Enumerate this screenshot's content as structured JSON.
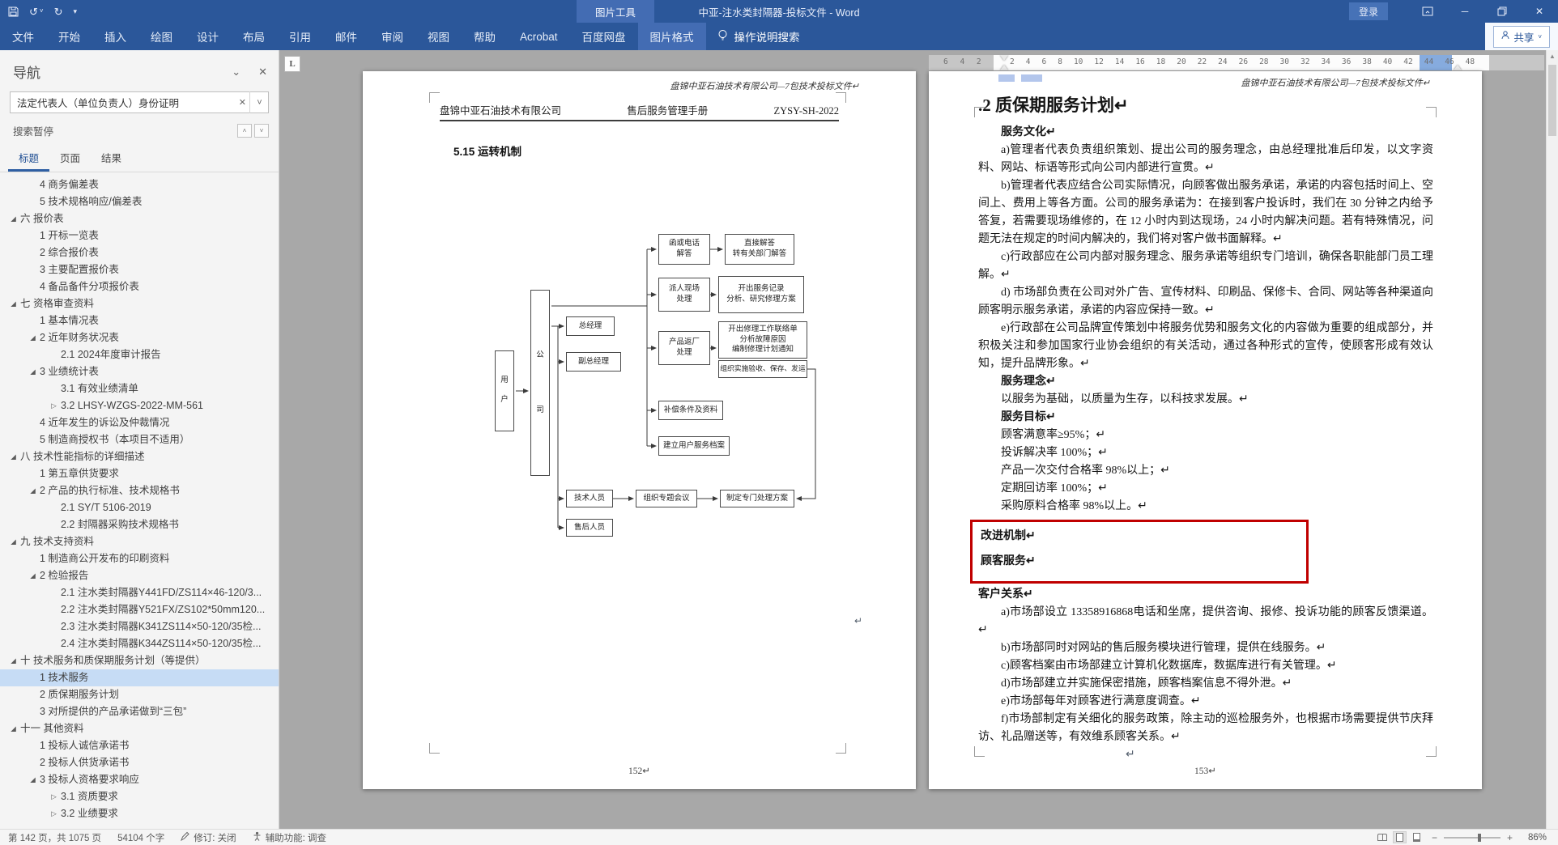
{
  "titlebar": {
    "title": "中亚-注水类封隔器-投标文件 - Word",
    "context_group": "图片工具",
    "signin_label": "登录"
  },
  "ribbon": {
    "tabs": [
      "文件",
      "开始",
      "插入",
      "绘图",
      "设计",
      "布局",
      "引用",
      "邮件",
      "审阅",
      "视图",
      "帮助",
      "Acrobat",
      "百度网盘",
      "图片格式"
    ],
    "search_label": "操作说明搜索",
    "share_label": "共享"
  },
  "nav": {
    "title": "导航",
    "search_value": "法定代表人（单位负责人）身份证明",
    "search_status": "搜索暂停",
    "tabs": [
      "标题",
      "页面",
      "结果"
    ],
    "items": [
      {
        "tri": "",
        "label": "4 商务偏差表"
      },
      {
        "tri": "",
        "label": "5 技术规格响应/偏差表"
      },
      {
        "tri": "◢",
        "label": "六 报价表"
      },
      {
        "tri": "",
        "label": "1 开标一览表"
      },
      {
        "tri": "",
        "label": "2 综合报价表"
      },
      {
        "tri": "",
        "label": "3 主要配置报价表"
      },
      {
        "tri": "",
        "label": "4 备品备件分项报价表"
      },
      {
        "tri": "◢",
        "label": "七 资格审查资料"
      },
      {
        "tri": "",
        "label": "1 基本情况表"
      },
      {
        "tri": "◢",
        "label": "2 近年财务状况表"
      },
      {
        "tri": "",
        "label": "2.1 2024年度审计报告"
      },
      {
        "tri": "◢",
        "label": "3 业绩统计表"
      },
      {
        "tri": "",
        "label": "3.1 有效业绩清单"
      },
      {
        "tri": "▷",
        "label": "3.2 LHSY-WZGS-2022-MM-561"
      },
      {
        "tri": "",
        "label": "4 近年发生的诉讼及仲裁情况"
      },
      {
        "tri": "",
        "label": "5 制造商授权书（本项目不适用）"
      },
      {
        "tri": "◢",
        "label": "八 技术性能指标的详细描述"
      },
      {
        "tri": "",
        "label": "1 第五章供货要求"
      },
      {
        "tri": "◢",
        "label": "2 产品的执行标准、技术规格书"
      },
      {
        "tri": "",
        "label": "2.1 SY/T 5106-2019"
      },
      {
        "tri": "",
        "label": "2.2 封隔器采购技术规格书"
      },
      {
        "tri": "◢",
        "label": "九 技术支持资料"
      },
      {
        "tri": "",
        "label": "1 制造商公开发布的印刷资料"
      },
      {
        "tri": "◢",
        "label": "2 检验报告"
      },
      {
        "tri": "",
        "label": "2.1 注水类封隔器Y441FD/ZS114×46-120/3..."
      },
      {
        "tri": "",
        "label": "2.2 注水类封隔器Y521FX/ZS102*50mm120..."
      },
      {
        "tri": "",
        "label": "2.3 注水类封隔器K341ZS114×50-120/35检..."
      },
      {
        "tri": "",
        "label": "2.4 注水类封隔器K344ZS114×50-120/35检..."
      },
      {
        "tri": "◢",
        "label": "十 技术服务和质保期服务计划（等提供）"
      },
      {
        "tri": "",
        "label": "1 技术服务"
      },
      {
        "tri": "",
        "label": "2 质保期服务计划"
      },
      {
        "tri": "",
        "label": "3 对所提供的产品承诺做到“三包”"
      },
      {
        "tri": "◢",
        "label": "十一 其他资料"
      },
      {
        "tri": "",
        "label": "1 投标人诚信承诺书"
      },
      {
        "tri": "",
        "label": "2 投标人供货承诺书"
      },
      {
        "tri": "◢",
        "label": "3 投标人资格要求响应"
      },
      {
        "tri": "▷",
        "label": "3.1 资质要求"
      },
      {
        "tri": "▷",
        "label": "3.2 业绩要求"
      }
    ]
  },
  "ruler": {
    "tab_selector": "L",
    "margin_numbers": "6 4 2",
    "numbers": "2 4 6 8 10 12 14 16 18 20 22 24 26 28 30 32 34 36 38 40 42 44 46 48"
  },
  "left_page": {
    "top_header": "盘锦中亚石油技术有限公司—7包技术投标文件↵",
    "company": "盘锦中亚石油技术有限公司",
    "manual": "售后服务管理手册",
    "doc_code": "ZYSY-SH-2022",
    "section": "5.15 运转机制",
    "pilcrow": "↵",
    "page_number": "152↵"
  },
  "flow": {
    "user": "用\n户",
    "company": "公\n司",
    "general_manager": "总经理",
    "deputy_general_manager": "副总经理",
    "letter_or_phone": "函或电话\n解答",
    "direct_answer": "直接解答\n转有关部门解答",
    "dispatch_onsite": "派人现场\n处理",
    "service_record": "开出服务记录\n分析、研究修理方案",
    "product_return": "产品返厂\n处理",
    "repair_order": "开出修理工作联络单\n分析故障原因\n编制修理计划通知",
    "organize_acceptance": "组织实施验收、保存、发运",
    "compensation": "补偿条件及资料",
    "user_archive": "建立用户服务档案",
    "tech_staff": "技术人员",
    "special_meeting": "组织专题会议",
    "special_plan": "制定专门处理方案",
    "aftersales_staff": "售后人员"
  },
  "right_page": {
    "top_header": "盘锦中亚石油技术有限公司—7包技术投标文件↵",
    "page_number": "153↵",
    "paras": [
      ".2 质保期服务计划↵",
      "服务文化↵",
      "a)管理者代表负责组织策划、提出公司的服务理念，由总经理批准后印发，以文字资料、网站、标语等形式向公司内部进行宣贯。↵",
      "b)管理者代表应结合公司实际情况，向顾客做出服务承诺，承诺的内容包括时间上、空间上、费用上等各方面。公司的服务承诺为：在接到客户投诉时，我们在 30 分钟之内给予答复，若需要现场维修的，在 12 小时内到达现场，24 小时内解决问题。若有特殊情况，问题无法在规定的时间内解决的，我们将对客户做书面解释。↵",
      "c)行政部应在公司内部对服务理念、服务承诺等组织专门培训，确保各职能部门员工理解。↵",
      "d) 市场部负责在公司对外广告、宣传材料、印刷品、保修卡、合同、网站等各种渠道向顾客明示服务承诺，承诺的内容应保持一致。↵",
      "e)行政部在公司品牌宣传策划中将服务优势和服务文化的内容做为重要的组成部分，并积极关注和参加国家行业协会组织的有关活动，通过各种形式的宣传，使顾客形成有效认知，提升品牌形象。↵",
      "服务理念↵",
      "以服务为基础，以质量为生存，以科技求发展。↵",
      "服务目标↵",
      "顾客满意率≥95%；↵",
      "投诉解决率 100%；↵",
      "产品一次交付合格率 98%以上；↵",
      "定期回访率 100%；↵",
      "采购原料合格率 98%以上。↵",
      "改进机制↵",
      "顾客服务↵",
      "客户关系↵",
      "a)市场部设立 13358916868电话和坐席，提供咨询、报修、投诉功能的顾客反馈渠道。↵",
      "b)市场部同时对网站的售后服务模块进行管理，提供在线服务。↵",
      "c)顾客档案由市场部建立计算机化数据库，数据库进行有关管理。↵",
      "d)市场部建立并实施保密措施，顾客档案信息不得外泄。↵",
      "e)市场部每年对顾客进行满意度调查。↵",
      "f)市场部制定有关细化的服务政策，除主动的巡检服务外，也根据市场需要提供节庆拜访、礼品赠送等，有效维系顾客关系。↵",
      "↵"
    ]
  },
  "statusbar": {
    "page_info": "第 142 页，共 1075 页",
    "word_count": "54104 个字",
    "track_changes": "修订: 关闭",
    "accessibility": "辅助功能: 调查",
    "zoom_level": "86%"
  }
}
